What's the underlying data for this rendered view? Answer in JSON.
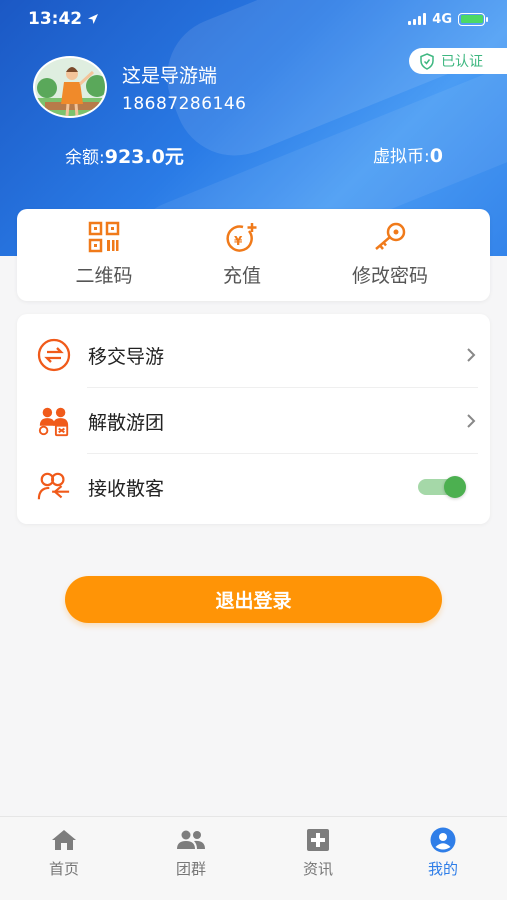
{
  "status_bar": {
    "time": "13:42",
    "network": "4G"
  },
  "profile": {
    "name": "这是导游端",
    "phone": "18687286146",
    "verified_label": "已认证",
    "balance_label": "余额:",
    "balance_value": "923.0元",
    "coins_label": "虚拟币:",
    "coins_value": "0"
  },
  "quick_actions": [
    {
      "label": "二维码",
      "icon": "qr-code-icon"
    },
    {
      "label": "充值",
      "icon": "coin-plus-icon"
    },
    {
      "label": "修改密码",
      "icon": "key-icon"
    }
  ],
  "menu": [
    {
      "label": "移交导游",
      "icon": "transfer-icon",
      "control": "chevron"
    },
    {
      "label": "解散游团",
      "icon": "group-dissolve-icon",
      "control": "chevron"
    },
    {
      "label": "接收散客",
      "icon": "receive-guest-icon",
      "control": "toggle",
      "toggle_on": true
    }
  ],
  "logout_label": "退出登录",
  "tabs": [
    {
      "label": "首页",
      "icon": "home-icon",
      "active": false
    },
    {
      "label": "团群",
      "icon": "people-icon",
      "active": false
    },
    {
      "label": "资讯",
      "icon": "news-icon",
      "active": false
    },
    {
      "label": "我的",
      "icon": "user-icon",
      "active": true
    }
  ],
  "colors": {
    "accent_orange": "#ff9406",
    "brand_blue": "#2f7ee8",
    "toggle_green": "#4cb050",
    "verified_green": "#3eb780"
  }
}
